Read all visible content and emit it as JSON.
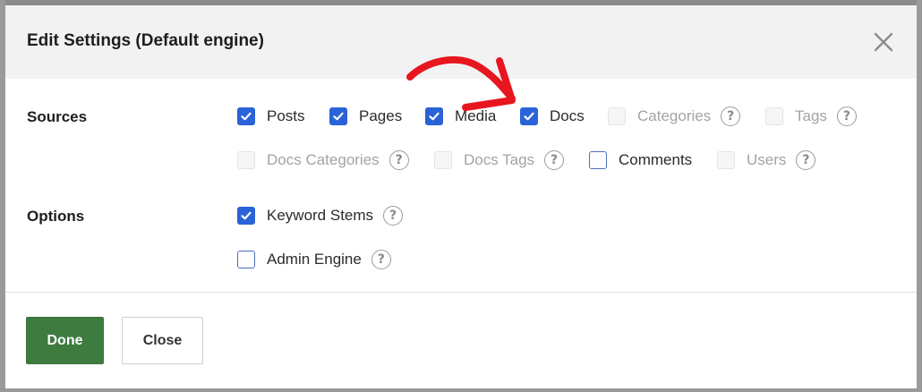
{
  "dialog": {
    "title": "Edit Settings (Default engine)"
  },
  "sources": {
    "label": "Sources",
    "items": [
      {
        "label": "Posts",
        "checked": true,
        "disabled": false
      },
      {
        "label": "Pages",
        "checked": true,
        "disabled": false
      },
      {
        "label": "Media",
        "checked": true,
        "disabled": false
      },
      {
        "label": "Docs",
        "checked": true,
        "disabled": false
      },
      {
        "label": "Categories",
        "checked": false,
        "disabled": true
      },
      {
        "label": "Tags",
        "checked": false,
        "disabled": true
      },
      {
        "label": "Docs Categories",
        "checked": false,
        "disabled": true
      },
      {
        "label": "Docs Tags",
        "checked": false,
        "disabled": true
      },
      {
        "label": "Comments",
        "checked": false,
        "disabled": false
      },
      {
        "label": "Users",
        "checked": false,
        "disabled": true
      }
    ]
  },
  "options": {
    "label": "Options",
    "items": [
      {
        "label": "Keyword Stems",
        "checked": true
      },
      {
        "label": "Admin Engine",
        "checked": false
      }
    ]
  },
  "footer": {
    "done_label": "Done",
    "close_label": "Close"
  },
  "help_glyph": "?",
  "colors": {
    "accent_checkbox": "#2a62d8",
    "done_button": "#3e7b3f",
    "annotation_arrow": "#e8161f"
  }
}
